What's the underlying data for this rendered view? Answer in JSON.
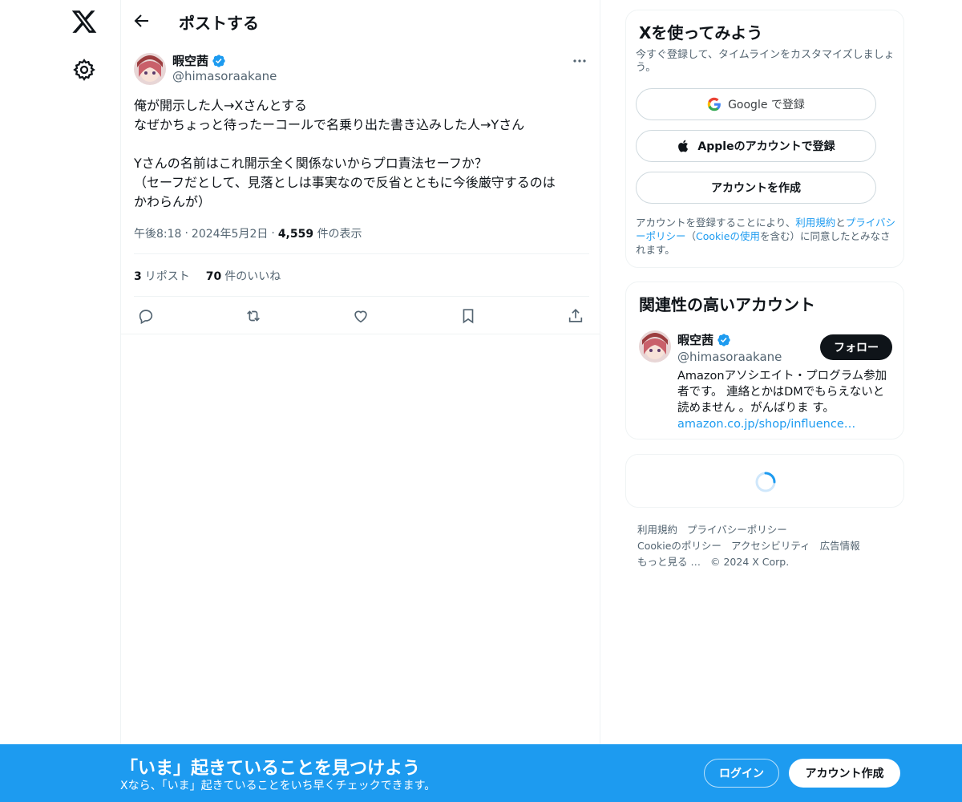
{
  "nav": {
    "logo_icon": "x-logo-icon",
    "settings_icon": "gear-icon"
  },
  "header": {
    "back_icon": "arrow-left-icon",
    "title": "ポストする"
  },
  "post": {
    "author_name": "暇空茜",
    "author_handle": "@himasoraakane",
    "text": "俺が開示した人→Xさんとする\nなぜかちょっと待ったーコールで名乗り出た書き込みした人→Yさん\n\nYさんの名前はこれ開示全く関係ないからプロ責法セーフか？\n（セーフだとして、見落としは事実なので反省とともに今後厳守するのは\nかわらんが）",
    "time": "午後8:18",
    "date": "2024年5月2日",
    "views_count": "4,559",
    "views_label": "件の表示",
    "separator": "·",
    "reposts_count": "3",
    "reposts_label": "リポスト",
    "likes_count": "70",
    "likes_label": "件のいいね"
  },
  "signup_card": {
    "title": "Xを使ってみよう",
    "subtitle": "今すぐ登録して、タイムラインをカスタマイズしましょう。",
    "google_label": "Google で登録",
    "apple_label": "Appleのアカウントで登録",
    "create_label": "アカウントを作成",
    "legal_1": "アカウントを登録することにより、",
    "legal_terms": "利用規約",
    "legal_2": "と",
    "legal_privacy": "プライバシーポリシー",
    "legal_3": "（",
    "legal_cookie": "Cookieの使用",
    "legal_4": "を含む）に同意したとみなされます。"
  },
  "related_card": {
    "title": "関連性の高いアカウント",
    "name": "暇空茜",
    "handle": "@himasoraakane",
    "follow_label": "フォロー",
    "bio": "Amazonアソシエイト・プログラム参加者です。 連絡とかはDMでもらえないと読めません 。がんばりま す。",
    "bio_link": "amazon.co.jp/shop/influence…"
  },
  "footer": {
    "terms": "利用規約",
    "privacy": "プライバシーポリシー",
    "cookie": "Cookieのポリシー",
    "accessibility": "アクセシビリティ",
    "ads": "広告情報",
    "more": "もっと見る …",
    "copyright": "© 2024 X Corp."
  },
  "banner": {
    "title": "「いま」起きていることを見つけよう",
    "subtitle": "Xなら、「いま」起きていることをいち早くチェックできます。",
    "login_label": "ログイン",
    "signup_label": "アカウント作成"
  },
  "colors": {
    "accent": "#1d9bf0",
    "text": "#0f1419",
    "muted": "#536471",
    "border": "#eff3f4"
  }
}
